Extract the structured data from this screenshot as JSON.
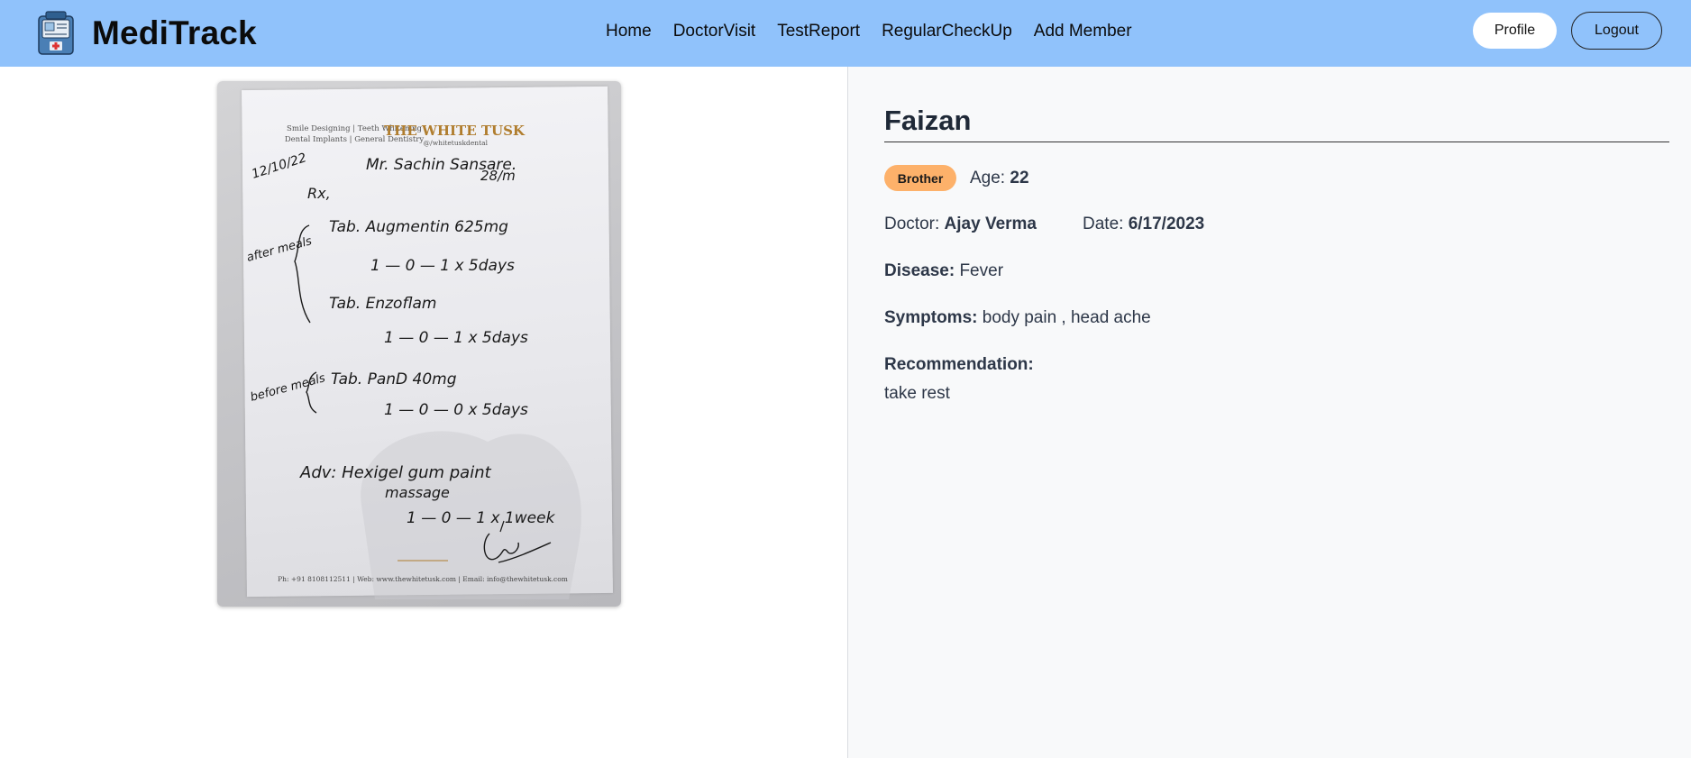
{
  "app": {
    "name": "MediTrack",
    "logo_icon": "medical-kit-icon"
  },
  "nav": {
    "links": [
      "Home",
      "DoctorVisit",
      "TestReport",
      "RegularCheckUp",
      "Add Member"
    ],
    "profile_label": "Profile",
    "logout_label": "Logout"
  },
  "colors": {
    "navbar": "#90c2fb",
    "badge": "#fdb16a",
    "right_panel_bg": "#f8f9fa"
  },
  "prescription_image": {
    "clinic_tagline_1": "Smile Designing | Teeth Whitening",
    "clinic_tagline_2": "Dental Implants | General Dentistry",
    "clinic_name": "THE WHITE TUSK",
    "clinic_handle": "@/whitetuskdental",
    "date": "12/10/22",
    "patient": "Mr. Sachin Sansare.",
    "patient_age": "28/m",
    "rx": "Rx,",
    "after_meals": "after meals",
    "before_meals": "before meals",
    "line_1": "Tab. Augmentin 625mg",
    "line_1_dose": "1 — 0 — 1   x 5days",
    "line_2": "Tab. Enzoflam",
    "line_2_dose": "1 — 0 — 1   x 5days",
    "line_3": "Tab. PanD 40mg",
    "line_3_dose": "1 — 0 — 0   x 5days",
    "advice": "Adv: Hexigel gum paint",
    "advice_2": "massage",
    "advice_dose": "1 — 0 — 1   x 1week",
    "footer": "Ph: +91 8108112511 | Web: www.thewhitetusk.com | Email: info@thewhitetusk.com"
  },
  "visit": {
    "member_name": "Faizan",
    "relation": "Brother",
    "age_label": "Age:",
    "age": "22",
    "doctor_label": "Doctor:",
    "doctor": "Ajay Verma",
    "date_label": "Date:",
    "date": "6/17/2023",
    "disease_label": "Disease:",
    "disease": "Fever",
    "symptoms_label": "Symptoms:",
    "symptoms": "body pain , head ache",
    "recommendation_label": "Recommendation:",
    "recommendation": "take rest"
  }
}
